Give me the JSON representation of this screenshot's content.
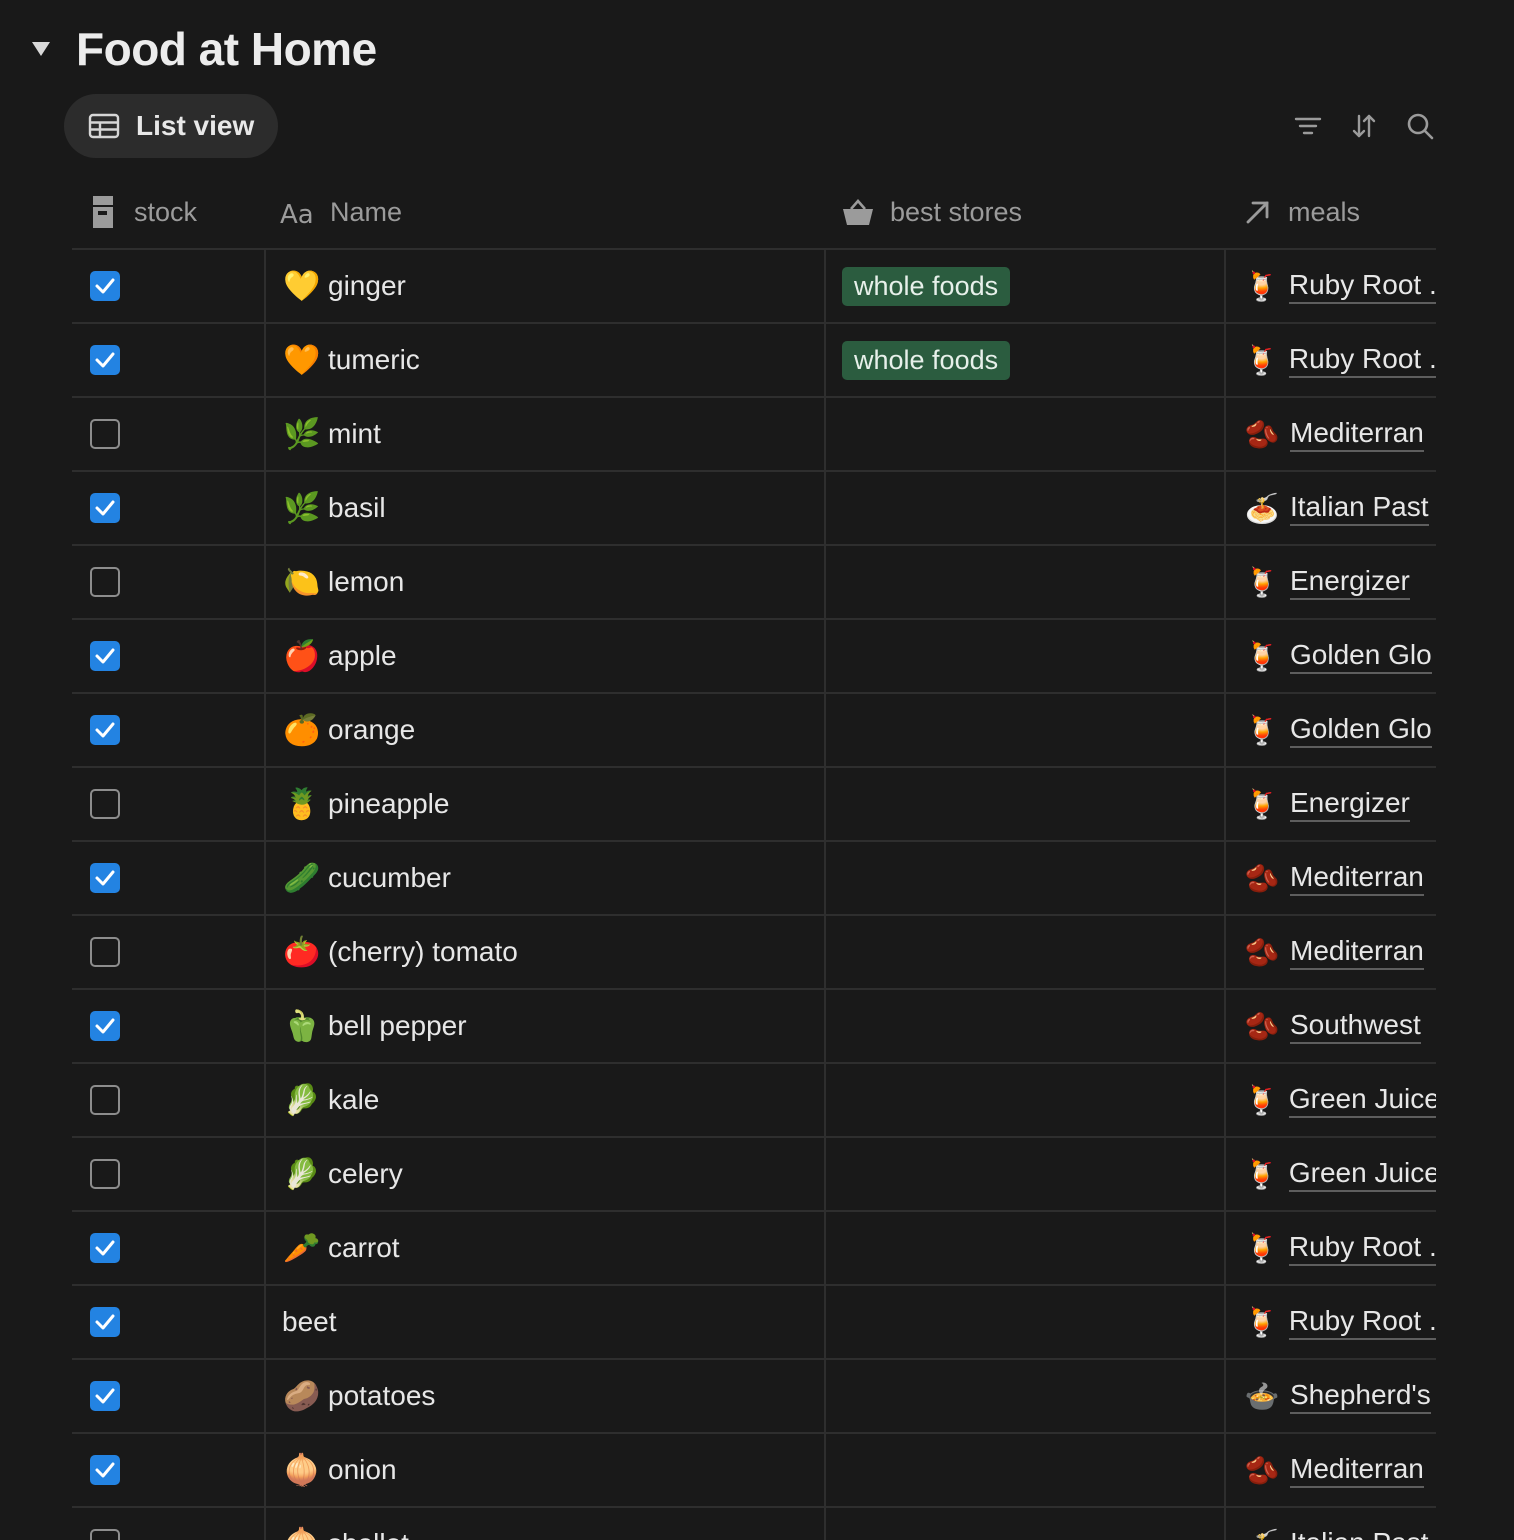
{
  "header": {
    "title": "Food at Home",
    "view_label": "List view"
  },
  "columns": {
    "stock": "stock",
    "name": "Name",
    "stores": "best stores",
    "meals": "meals"
  },
  "colors": {
    "background": "#191919",
    "checkbox_checked": "#2383e2",
    "store_tag": "#2b5c3f"
  },
  "rows": [
    {
      "checked": true,
      "emoji": "💛",
      "name": "ginger",
      "store": "whole foods",
      "meal_emoji": "🍹",
      "meal": "Ruby Root ."
    },
    {
      "checked": true,
      "emoji": "🧡",
      "name": "tumeric",
      "store": "whole foods",
      "meal_emoji": "🍹",
      "meal": "Ruby Root ."
    },
    {
      "checked": false,
      "emoji": "🌿",
      "name": "mint",
      "store": "",
      "meal_emoji": "🫘",
      "meal": "Mediterran"
    },
    {
      "checked": true,
      "emoji": "🌿",
      "name": "basil",
      "store": "",
      "meal_emoji": "🍝",
      "meal": "Italian Past"
    },
    {
      "checked": false,
      "emoji": "🍋",
      "name": "lemon",
      "store": "",
      "meal_emoji": "🍹",
      "meal": "Energizer"
    },
    {
      "checked": true,
      "emoji": "🍎",
      "name": "apple",
      "store": "",
      "meal_emoji": "🍹",
      "meal": "Golden Glo"
    },
    {
      "checked": true,
      "emoji": "🍊",
      "name": "orange",
      "store": "",
      "meal_emoji": "🍹",
      "meal": "Golden Glo"
    },
    {
      "checked": false,
      "emoji": "🍍",
      "name": "pineapple",
      "store": "",
      "meal_emoji": "🍹",
      "meal": "Energizer"
    },
    {
      "checked": true,
      "emoji": "🥒",
      "name": "cucumber",
      "store": "",
      "meal_emoji": "🫘",
      "meal": "Mediterran"
    },
    {
      "checked": false,
      "emoji": "🍅",
      "name": "(cherry) tomato",
      "store": "",
      "meal_emoji": "🫘",
      "meal": "Mediterran"
    },
    {
      "checked": true,
      "emoji": "🫑",
      "name": "bell pepper",
      "store": "",
      "meal_emoji": "🫘",
      "meal": "Southwest"
    },
    {
      "checked": false,
      "emoji": "🥬",
      "name": "kale",
      "store": "",
      "meal_emoji": "🍹",
      "meal": "Green Juice"
    },
    {
      "checked": false,
      "emoji": "🥬",
      "name": "celery",
      "store": "",
      "meal_emoji": "🍹",
      "meal": "Green Juice"
    },
    {
      "checked": true,
      "emoji": "🥕",
      "name": "carrot",
      "store": "",
      "meal_emoji": "🍹",
      "meal": "Ruby Root ."
    },
    {
      "checked": true,
      "emoji": "",
      "name": "beet",
      "store": "",
      "meal_emoji": "🍹",
      "meal": "Ruby Root ."
    },
    {
      "checked": true,
      "emoji": "🥔",
      "name": "potatoes",
      "store": "",
      "meal_emoji": "🍲",
      "meal": "Shepherd's"
    },
    {
      "checked": true,
      "emoji": "🧅",
      "name": "onion",
      "store": "",
      "meal_emoji": "🫘",
      "meal": "Mediterran"
    },
    {
      "checked": false,
      "emoji": "🧅",
      "name": "shallot",
      "store": "",
      "meal_emoji": "🍝",
      "meal": "Italian Past"
    }
  ]
}
